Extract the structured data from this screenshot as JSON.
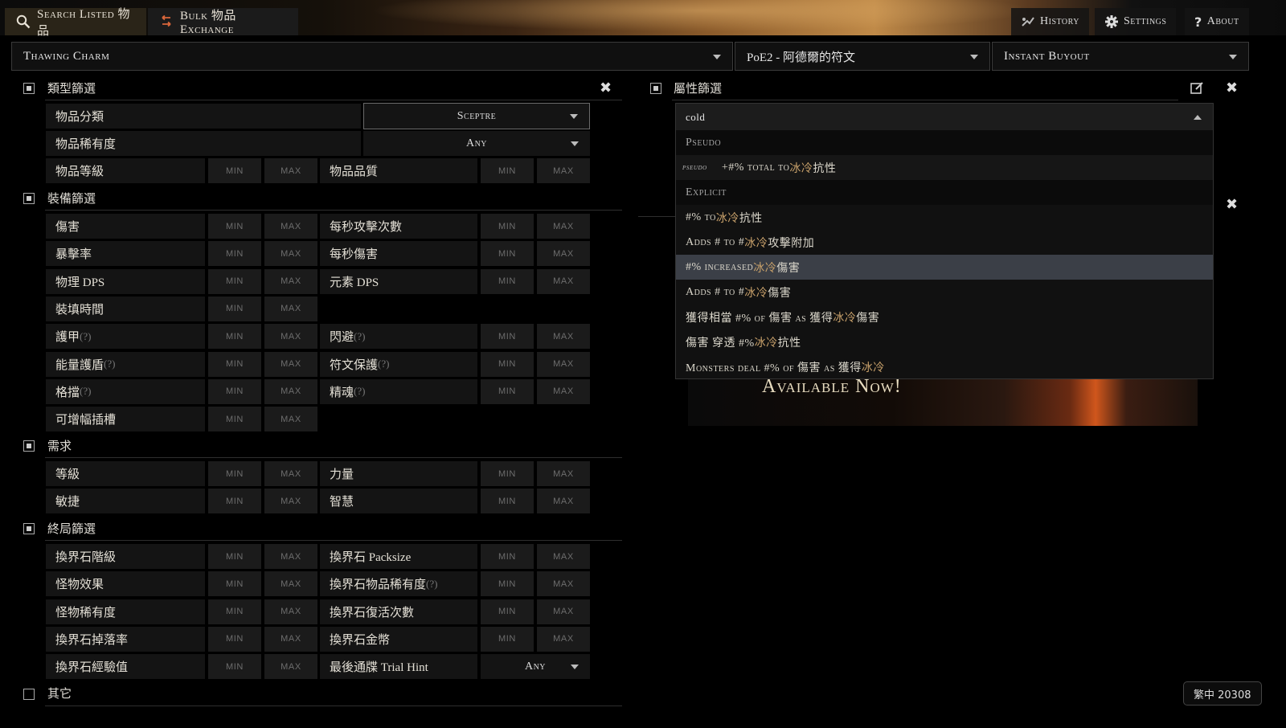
{
  "topbar": {
    "search_tab": "Search Listed 物品",
    "bulk_tab": "Bulk 物品 Exchange",
    "history": "History",
    "settings": "Settings",
    "about": "About"
  },
  "search": {
    "item_name": "Thawing Charm",
    "league": "PoE2 - 阿德爾的符文",
    "buyout": "Instant Buyout"
  },
  "placeholders": {
    "min": "MIN",
    "max": "MAX"
  },
  "type_filters": {
    "title": "類型篩選",
    "category_label": "物品分類",
    "category_value": "Sceptre",
    "rarity_label": "物品稀有度",
    "rarity_value": "Any",
    "level_label": "物品等級",
    "quality_label": "物品品質"
  },
  "equipment_filters": {
    "title": "裝備篩選",
    "left": [
      "傷害",
      "暴擊率",
      "物理 DPS",
      "裝填時間",
      "護甲",
      "能量護盾",
      "格擋",
      "可增幅插槽"
    ],
    "right": [
      "每秒攻擊次數",
      "每秒傷害",
      "元素 DPS",
      "",
      "閃避",
      "符文保護",
      "精魂",
      ""
    ],
    "hint": "(?)"
  },
  "requirements": {
    "title": "需求",
    "left": [
      "等級",
      "敏捷"
    ],
    "right": [
      "力量",
      "智慧"
    ]
  },
  "endgame_filters": {
    "title": "終局篩選",
    "left": [
      "換界石階級",
      "怪物效果",
      "怪物稀有度",
      "換界石掉落率",
      "換界石經驗值"
    ],
    "right": [
      "換界石 Packsize",
      "換界石物品稀有度",
      "換界石復活次數",
      "換界石金幣",
      "最後通牒 Trial Hint"
    ],
    "trial_value": "Any"
  },
  "misc": {
    "title": "其它"
  },
  "stat_filters": {
    "title": "屬性篩選",
    "input": "cold",
    "groups": {
      "pseudo": "Pseudo",
      "explicit": "Explicit"
    },
    "pseudo_tag": "pseudo",
    "options": [
      {
        "pre": "+#% total to ",
        "hl": "冰冷",
        "post": "抗性"
      },
      {
        "pre": "#% to ",
        "hl": "冰冷",
        "post": "抗性"
      },
      {
        "pre": "Adds # to # ",
        "hl": "冰冷",
        "post": "攻擊附加"
      },
      {
        "pre": "#% increased ",
        "hl": "冰冷",
        "post": "傷害"
      },
      {
        "pre": "Adds # to # ",
        "hl": "冰冷",
        "post": "傷害"
      },
      {
        "pre": "獲得相當 #% of 傷害 as 獲得 ",
        "hl": "冰冷",
        "post": "傷害"
      },
      {
        "pre": "傷害 穿透 #% ",
        "hl": "冰冷",
        "post": "抗性"
      },
      {
        "pre": "Monsters deal #% of 傷害 as 獲得 ",
        "hl": "冰冷",
        "post": ""
      }
    ]
  },
  "banner": {
    "text": "Available Now!"
  },
  "footer": {
    "badge": "繁中 20308"
  },
  "colors": {
    "highlight": "#c7a06a",
    "selected_row": "#3b3f47"
  }
}
